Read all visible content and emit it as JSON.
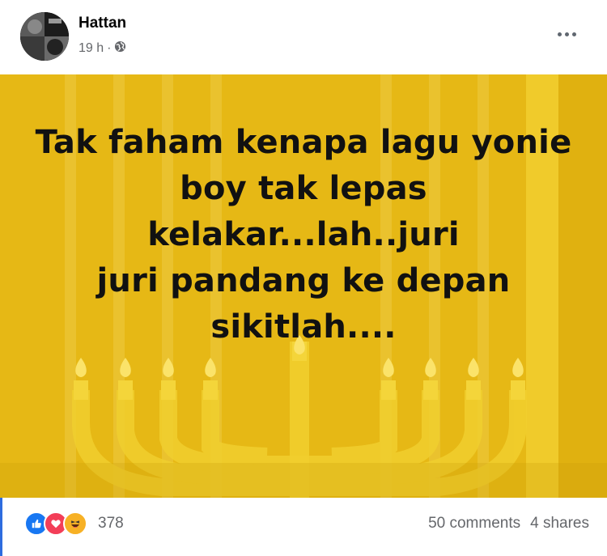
{
  "post": {
    "author": "Hattan",
    "time": "19 h",
    "separator": "·",
    "audience_icon": "globe-icon",
    "more_icon": "three-dots-icon",
    "text_lines": [
      "Tak faham kenapa lagu yonie",
      "boy tak lepas kelakar...lah..juri",
      "juri pandang ke depan",
      "sikitlah...."
    ],
    "background_color": "#e9bb17"
  },
  "footer": {
    "reaction_icons": [
      "like-icon",
      "love-icon",
      "haha-icon"
    ],
    "reaction_count": "378",
    "comments": "50 comments",
    "shares": "4 shares"
  },
  "colors": {
    "like": "#1877f2",
    "love": "#f33e58",
    "haha": "#f7b125",
    "muted_text": "#65676b"
  }
}
